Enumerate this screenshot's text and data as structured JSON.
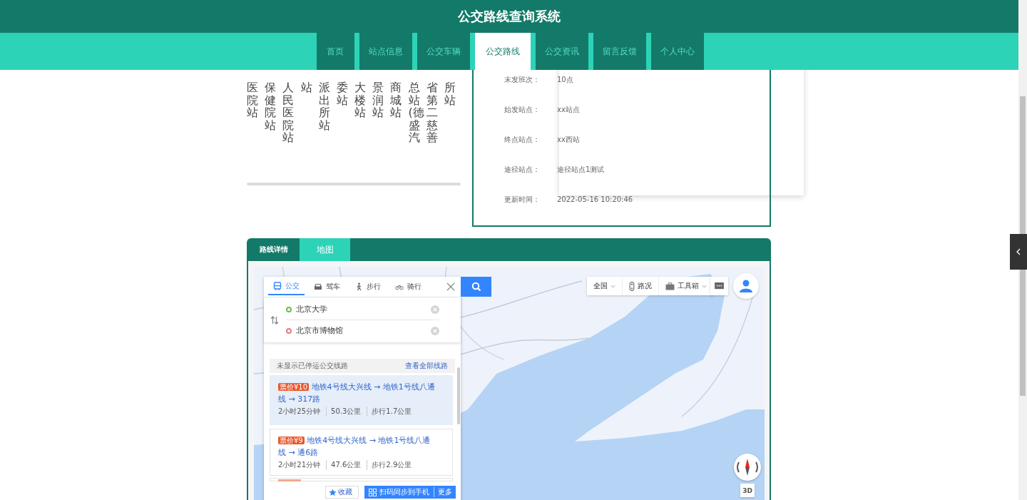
{
  "header": {
    "title": "公交路线查询系统"
  },
  "nav": [
    {
      "label": "首页",
      "selected": false
    },
    {
      "label": "站点信息",
      "selected": false
    },
    {
      "label": "公交车辆",
      "selected": false
    },
    {
      "label": "公交路线",
      "selected": true
    },
    {
      "label": "公交资讯",
      "selected": false
    },
    {
      "label": "留言反馈",
      "selected": false
    },
    {
      "label": "个人中心",
      "selected": false
    }
  ],
  "stations": [
    "医院站",
    "保健院站",
    "人民医院站",
    "站",
    "派出所站",
    "委站",
    "大楼站",
    "景润站",
    "商城站",
    "总站(德盛汽",
    "省第二慈善",
    "所站"
  ],
  "details": [
    {
      "label": "末发班次：",
      "value": "10点"
    },
    {
      "label": "始发站点：",
      "value": "xx站点"
    },
    {
      "label": "终点站点：",
      "value": "xx西站"
    },
    {
      "label": "途径站点：",
      "value": "途径站点1测试"
    },
    {
      "label": "更新时间：",
      "value": "2022-05-16 10:20:46"
    }
  ],
  "tabs": [
    {
      "label": "路线详情",
      "selected": false
    },
    {
      "label": "地图",
      "selected": true
    }
  ],
  "map": {
    "kind": "picture",
    "route_panel": {
      "modes": [
        {
          "kind": "bus",
          "label": "公交",
          "selected": true
        },
        {
          "kind": "car",
          "label": "驾车",
          "selected": false
        },
        {
          "kind": "walk",
          "label": "步行",
          "selected": false
        },
        {
          "kind": "bike",
          "label": "骑行",
          "selected": false
        }
      ],
      "endpoints": [
        {
          "value": "北京大学",
          "color": "#6cc04a"
        },
        {
          "value": "北京市博物馆",
          "color": "#ee7b7b"
        }
      ],
      "notice": "未显示已停运公交线路",
      "notice_link": "查看全部线路",
      "routes": [
        {
          "price": "票价¥10",
          "title": "地铁4号线大兴线 → 地铁1号线八通线 → 317路",
          "duration": "2小时25分钟",
          "distance": "50.3公里",
          "walk": "步行1.7公里",
          "selected": true
        },
        {
          "price": "票价¥9",
          "title": "地铁4号线大兴线 → 地铁1号线八通线 → 通6路",
          "duration": "2小时21分钟",
          "distance": "47.6公里",
          "walk": "步行2.9公里",
          "selected": false
        }
      ],
      "save_button": "收藏",
      "sync_button": "扫码同步到手机",
      "more_button": "更多"
    },
    "toolbar": [
      {
        "kind": "region",
        "label": "全国",
        "dropdown": true
      },
      {
        "kind": "traffic",
        "label": "路况",
        "dropdown": false
      },
      {
        "kind": "toolbox",
        "label": "工具箱",
        "dropdown": true
      }
    ],
    "view_button": "3D"
  }
}
